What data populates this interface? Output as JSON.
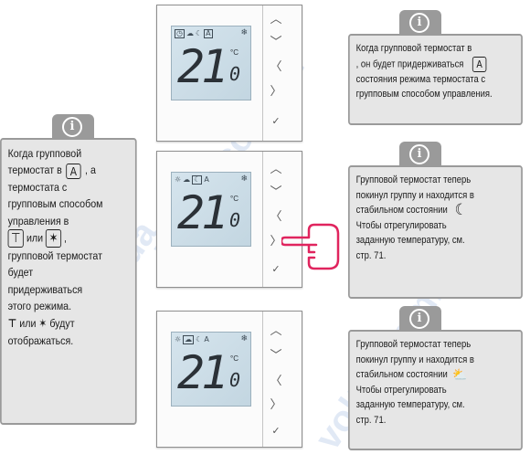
{
  "watermark": {
    "text": "voltar.com.ua"
  },
  "thermostats": [
    {
      "temp_main": "21",
      "temp_decimal": "0",
      "unit": "°C",
      "mode_icons": [
        "clock-icon",
        "cloud-sun-icon",
        "moon-icon",
        "A-icon"
      ],
      "highlight": "A"
    },
    {
      "temp_main": "21",
      "temp_decimal": "0",
      "unit": "°C",
      "mode_icons": [
        "sun-icon",
        "cloud-sun-icon",
        "moon-icon",
        "A-icon"
      ],
      "highlight": "moon"
    },
    {
      "temp_main": "21",
      "temp_decimal": "0",
      "unit": "°C",
      "mode_icons": [
        "sun-icon",
        "cloud-sun-icon",
        "moon-icon",
        "A-icon"
      ],
      "highlight": "cloud-sun"
    }
  ],
  "buttons": {
    "up": "︿",
    "down": "﹀",
    "left": "〈",
    "right": "〉",
    "ok": "✓"
  },
  "info_top_right": {
    "lines": [
      "Когда групповой термостат в",
      ", он будет придерживаться",
      "состояния режима термостата с",
      "групповым способом управления."
    ],
    "symbol": "A"
  },
  "info_left": {
    "line1": "Когда групповой",
    "line2a": "термостат в",
    "line2b": ", а",
    "line3": "термостата с",
    "line4": "групповым способом",
    "line5": "управления в",
    "line6": "или",
    "line7": "групповой термостат",
    "line8": "будет",
    "line9": "придерживаться",
    "line10": "этого режима.",
    "line11a": "или",
    "line11b": "будут",
    "line12": "отображаться.",
    "symbol_a": "A"
  },
  "info_middle_right": {
    "lines": [
      "Групповой термостат теперь",
      "покинул группу и находится в",
      "стабильном состоянии",
      "Чтобы отрегулировать",
      "заданную температуру, см.",
      "стр. 71."
    ]
  },
  "info_bottom_right": {
    "lines": [
      "Групповой термостат теперь",
      "покинул группу и находится в",
      "стабильном состоянии",
      "Чтобы отрегулировать",
      "заданную температуру, см.",
      "стр. 71."
    ]
  },
  "colors": {
    "box_bg": "#e6e6e6",
    "box_border": "#9a9a9a",
    "screen": "#ccdce6",
    "hand": "#e0245e",
    "watermark": "#4678be"
  }
}
